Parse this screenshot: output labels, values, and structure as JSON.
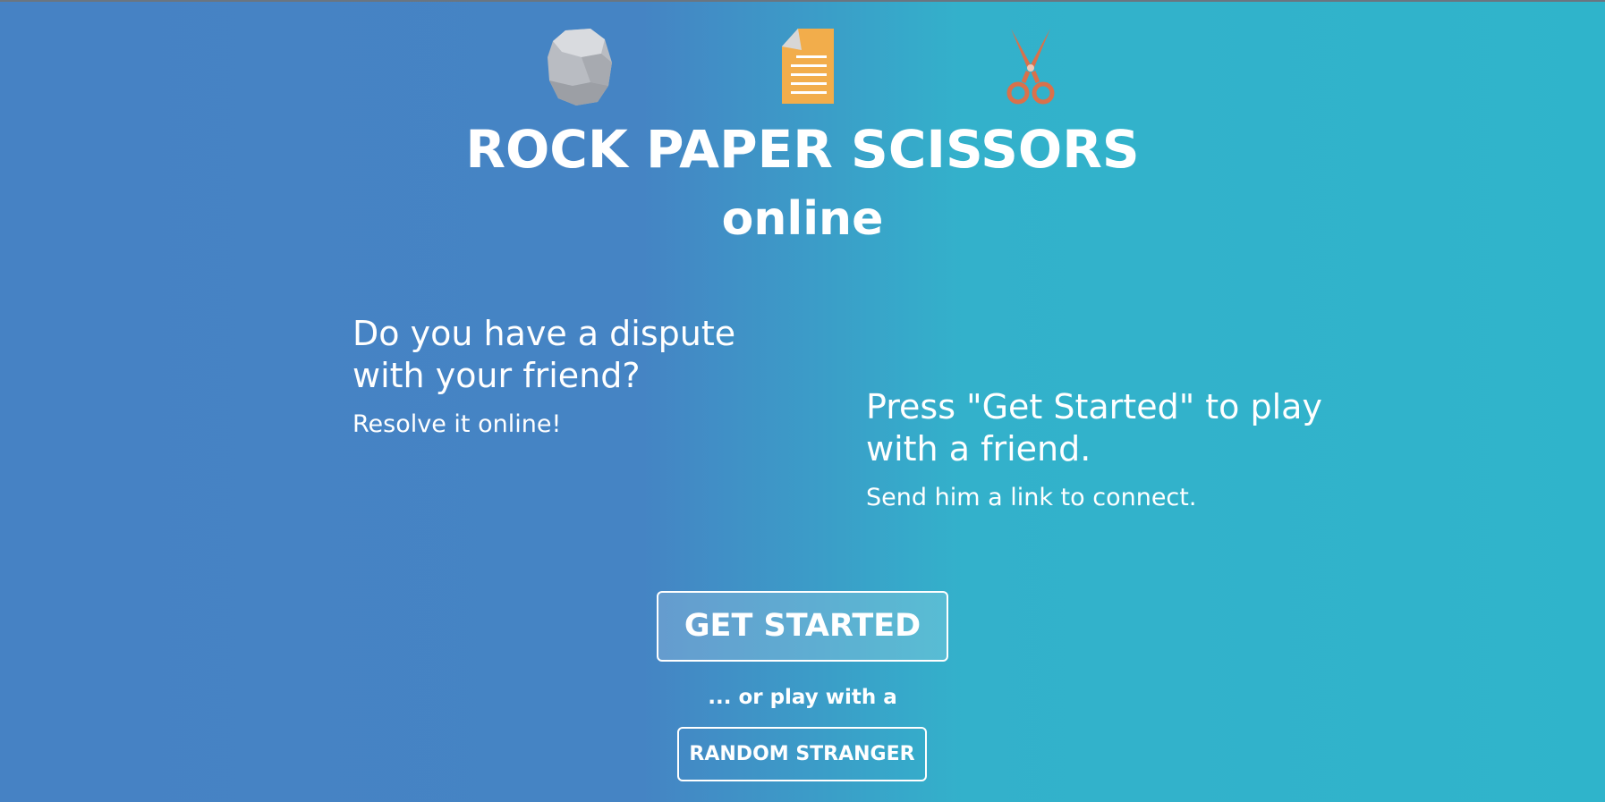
{
  "header": {
    "icons": [
      "rock-icon",
      "paper-icon",
      "scissors-icon"
    ],
    "title": "ROCK PAPER SCISSORS",
    "subtitle": "online"
  },
  "intro_left": {
    "heading": "Do you have a dispute with your friend?",
    "sub": "Resolve it online!"
  },
  "intro_right": {
    "heading": "Press \"Get Started\" to play with a friend.",
    "sub": "Send him a link to connect."
  },
  "actions": {
    "get_started_label": "GET STARTED",
    "or_play_text": "... or play with a",
    "random_stranger_label": "RANDOM STRANGER"
  },
  "colors": {
    "gradient_left": "#4682c4",
    "gradient_right": "#2fb4cb",
    "rock": "#b9bcc2",
    "paper": "#f2ad4b",
    "scissors": "#d9714b",
    "text": "#ffffff"
  }
}
